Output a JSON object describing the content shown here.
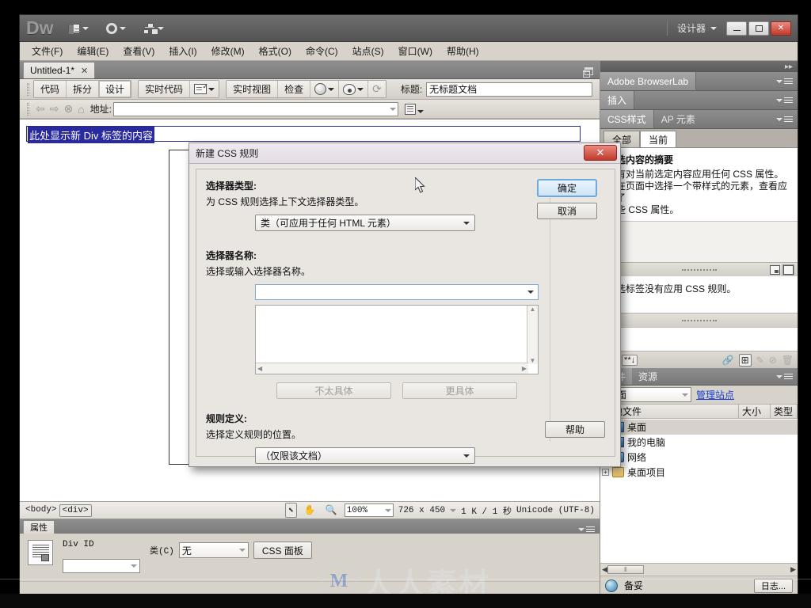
{
  "app": {
    "logo": "Dw",
    "workspace": "设计器",
    "window_buttons": {
      "minimize": "─",
      "maximize": "□",
      "close": "✕"
    },
    "toolbar_icons": [
      "layout-switcher-icon",
      "gear-icon",
      "site-manager-icon"
    ]
  },
  "menubar": {
    "items": [
      {
        "label": "文件(F)"
      },
      {
        "label": "编辑(E)"
      },
      {
        "label": "查看(V)"
      },
      {
        "label": "插入(I)"
      },
      {
        "label": "修改(M)"
      },
      {
        "label": "格式(O)"
      },
      {
        "label": "命令(C)"
      },
      {
        "label": "站点(S)"
      },
      {
        "label": "窗口(W)"
      },
      {
        "label": "帮助(H)"
      }
    ]
  },
  "document": {
    "tab_title": "Untitled-1*",
    "tab_close": "✕",
    "view_buttons": [
      {
        "label": "代码",
        "active": false
      },
      {
        "label": "拆分",
        "active": false
      },
      {
        "label": "设计",
        "active": true
      }
    ],
    "live_code": "实时代码",
    "live_view": "实时视图",
    "inspect": "检查",
    "title_label": "标题:",
    "title_value": "无标题文档",
    "address_label": "地址:",
    "address_value": "",
    "canvas_text": "此处显示新 Div 标签的内容"
  },
  "statusbar": {
    "tags": [
      "<body>",
      "<div>"
    ],
    "zoom": "100%",
    "dimensions": "726 x 450",
    "filesize": "1 K / 1 秒",
    "encoding": "Unicode (UTF-8)"
  },
  "properties": {
    "tab_label": "属性",
    "div_id_label": "Div ID",
    "div_id_value": "",
    "class_label": "类(C)",
    "class_value": "无",
    "css_panel_button": "CSS 面板"
  },
  "right_panels": {
    "browserlab": {
      "title": "Adobe BrowserLab"
    },
    "insert": {
      "title": "插入"
    },
    "css_styles": {
      "tabs": [
        {
          "label": "CSS样式",
          "active": true
        },
        {
          "label": "AP 元素",
          "active": false
        }
      ],
      "filter_buttons": [
        {
          "label": "全部",
          "active": false
        },
        {
          "label": "当前",
          "active": true
        }
      ],
      "summary_title": "所选内容的摘要",
      "summary_lines": [
        "没有对当前选定内容应用任何 CSS 属性。",
        "请在页面中选择一个带样式的元素，查看应用了",
        "哪些 CSS 属性。"
      ],
      "rule_text": "所选标签没有应用 CSS 规则。",
      "toolbar_icons": [
        "sort-az-icon",
        "category-icon",
        "attach-stylesheet-icon",
        "new-css-rule-icon",
        "edit-rule-icon",
        "disable-rule-icon",
        "delete-rule-icon"
      ]
    },
    "files": {
      "tabs": [
        {
          "label": "文件",
          "active": true
        },
        {
          "label": "资源",
          "active": false
        }
      ],
      "site_select": "桌面",
      "manage_sites": "管理站点",
      "columns": [
        "本地文件",
        "大小",
        "类型"
      ],
      "tree": [
        {
          "label": "桌面",
          "icon": "monitor-icon",
          "depth": 0,
          "expandable": false,
          "selected": true
        },
        {
          "label": "我的电脑",
          "icon": "monitor-icon",
          "depth": 1,
          "expandable": true,
          "selected": false
        },
        {
          "label": "网络",
          "icon": "network-icon",
          "depth": 1,
          "expandable": true,
          "selected": false
        },
        {
          "label": "桌面项目",
          "icon": "folder-icon",
          "depth": 1,
          "expandable": true,
          "selected": false
        }
      ],
      "status_text": "备妥",
      "log_button": "日志..."
    }
  },
  "dialog": {
    "title": "新建 CSS 规则",
    "close_label": "✕",
    "selector_type": {
      "heading": "选择器类型:",
      "description": "为 CSS 规则选择上下文选择器类型。",
      "value": "类（可应用于任何 HTML 元素）"
    },
    "selector_name": {
      "heading": "选择器名称:",
      "description": "选择或输入选择器名称。",
      "value": "",
      "less_specific": "不太具体",
      "more_specific": "更具体"
    },
    "rule_definition": {
      "heading": "规则定义:",
      "description": "选择定义规则的位置。",
      "value": "（仅限该文档）"
    },
    "buttons": {
      "ok": "确定",
      "cancel": "取消",
      "help": "帮助"
    }
  },
  "watermark": {
    "logo": "M",
    "text": "人人素材"
  }
}
